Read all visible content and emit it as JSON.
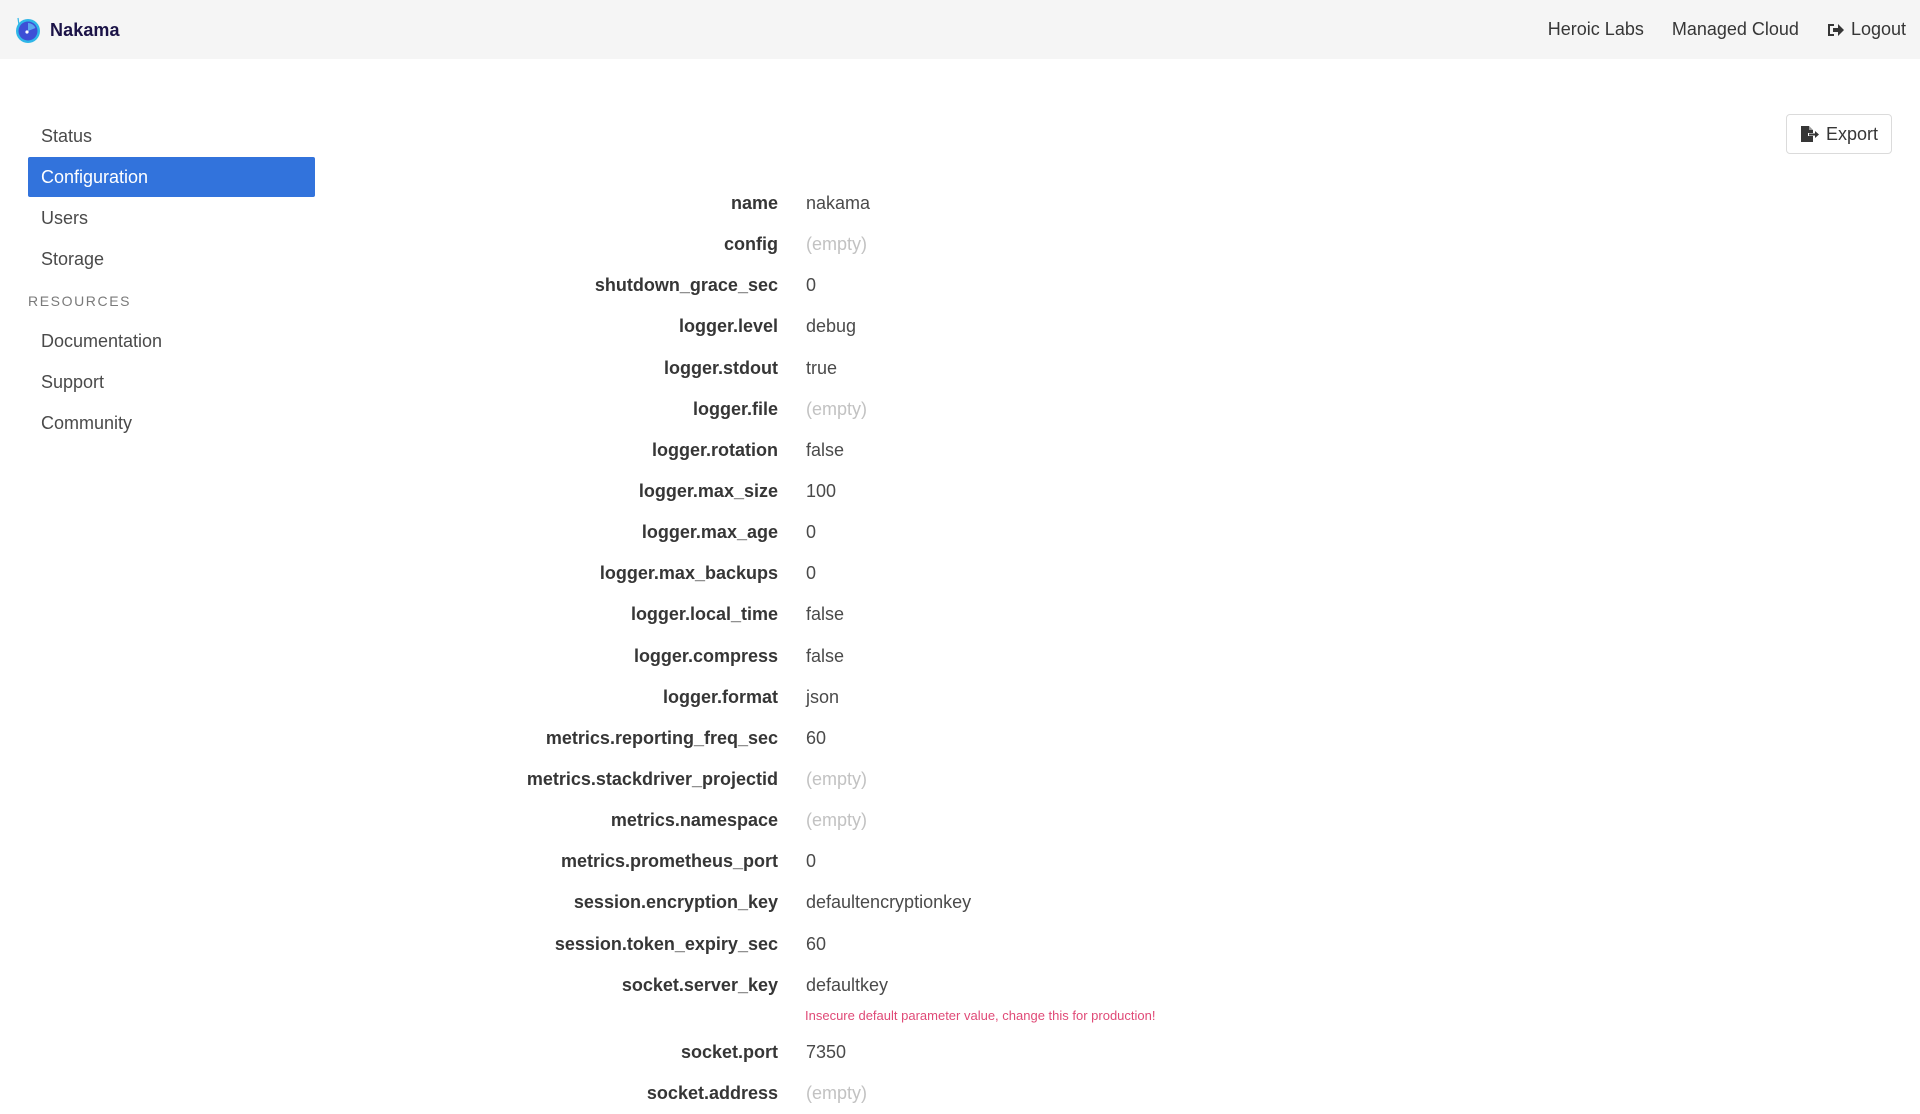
{
  "app": {
    "brand_name": "Nakama",
    "brand_icon": "nakama-logo-icon"
  },
  "topnav": {
    "links": [
      {
        "label": "Heroic Labs"
      },
      {
        "label": "Managed Cloud"
      },
      {
        "label": "Logout",
        "icon": "sign-out-icon"
      }
    ]
  },
  "sidebar": {
    "items": [
      {
        "label": "Status",
        "active": false
      },
      {
        "label": "Configuration",
        "active": true
      },
      {
        "label": "Users",
        "active": false
      },
      {
        "label": "Storage",
        "active": false
      }
    ],
    "section_label": "RESOURCES",
    "resources": [
      {
        "label": "Documentation"
      },
      {
        "label": "Support"
      },
      {
        "label": "Community"
      }
    ]
  },
  "toolbar": {
    "export_label": "Export",
    "export_icon": "file-export-icon"
  },
  "config": {
    "empty_placeholder": "(empty)",
    "rows": [
      {
        "key": "name",
        "value": "nakama"
      },
      {
        "key": "config",
        "value": "(empty)",
        "empty": true
      },
      {
        "key": "shutdown_grace_sec",
        "value": "0"
      },
      {
        "key": "logger.level",
        "value": "debug"
      },
      {
        "key": "logger.stdout",
        "value": "true"
      },
      {
        "key": "logger.file",
        "value": "(empty)",
        "empty": true
      },
      {
        "key": "logger.rotation",
        "value": "false"
      },
      {
        "key": "logger.max_size",
        "value": "100"
      },
      {
        "key": "logger.max_age",
        "value": "0"
      },
      {
        "key": "logger.max_backups",
        "value": "0"
      },
      {
        "key": "logger.local_time",
        "value": "false"
      },
      {
        "key": "logger.compress",
        "value": "false"
      },
      {
        "key": "logger.format",
        "value": "json"
      },
      {
        "key": "metrics.reporting_freq_sec",
        "value": "60"
      },
      {
        "key": "metrics.stackdriver_projectid",
        "value": "(empty)",
        "empty": true
      },
      {
        "key": "metrics.namespace",
        "value": "(empty)",
        "empty": true
      },
      {
        "key": "metrics.prometheus_port",
        "value": "0"
      },
      {
        "key": "session.encryption_key",
        "value": "defaultencryptionkey"
      },
      {
        "key": "session.token_expiry_sec",
        "value": "60"
      },
      {
        "key": "socket.server_key",
        "value": "defaultkey",
        "warning": "Insecure default parameter value, change this for production!"
      },
      {
        "key": "socket.port",
        "value": "7350"
      },
      {
        "key": "socket.address",
        "value": "(empty)",
        "empty": true
      }
    ]
  },
  "colors": {
    "accent": "#3273dc",
    "warning": "#e04a77",
    "topbar_bg": "#f5f5f5",
    "empty_text": "#c2c2c2"
  }
}
